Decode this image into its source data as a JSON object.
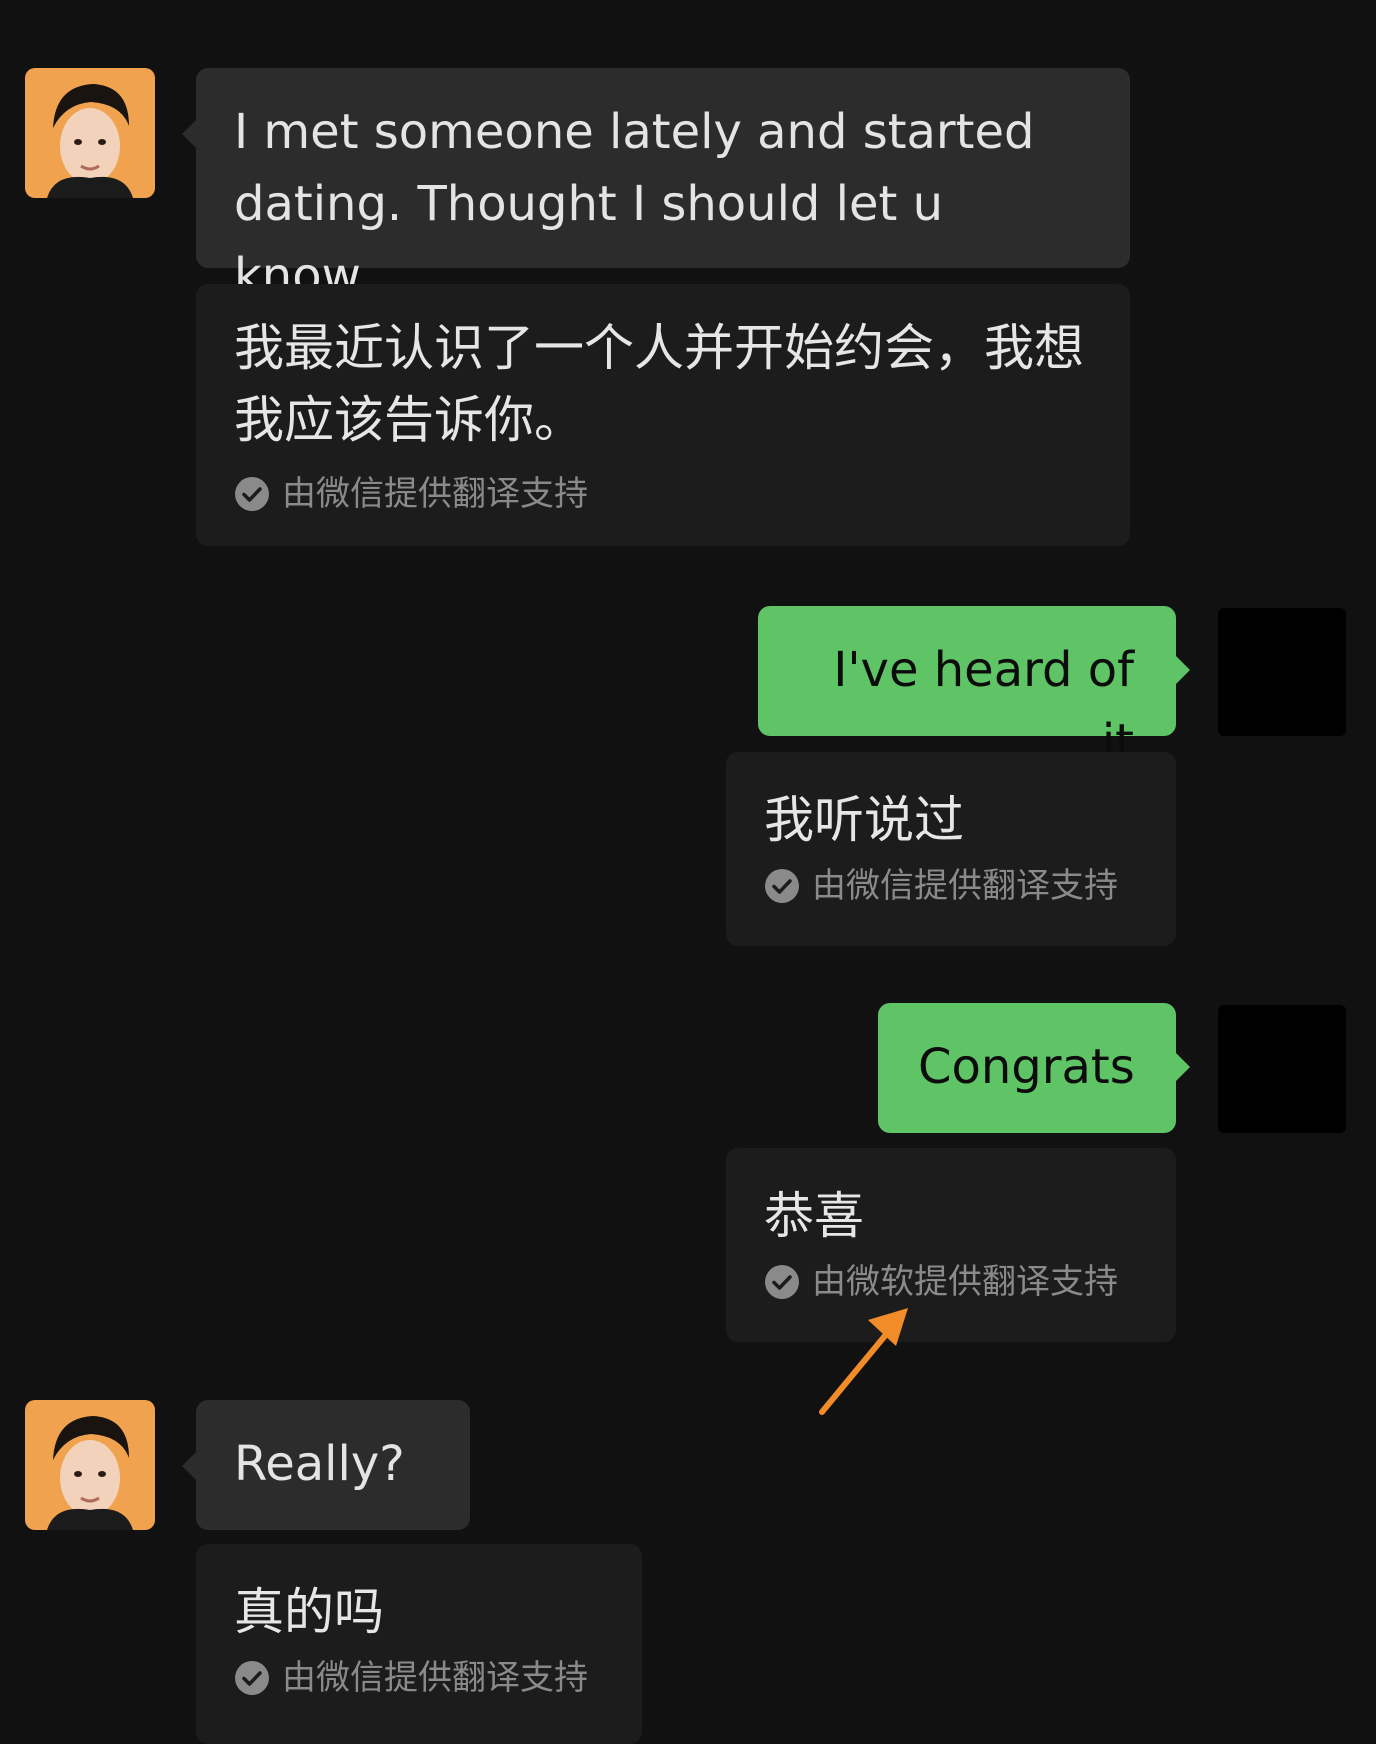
{
  "colors": {
    "background": "#111111",
    "incoming_bubble": "#2c2c2c",
    "outgoing_bubble": "#5fc466",
    "translation_card": "#1c1c1c",
    "attribution_text": "#8a8a8a",
    "annotation_arrow": "#f28c28"
  },
  "messages": [
    {
      "side": "left",
      "text": "I met someone lately and started dating.  Thought I should let u know.",
      "translation": "我最近认识了一个人并开始约会，我想我应该告诉你。",
      "attribution": "由微信提供翻译支持"
    },
    {
      "side": "right",
      "text": "I've heard of it",
      "translation": "我听说过",
      "attribution": "由微信提供翻译支持"
    },
    {
      "side": "right",
      "text": "Congrats",
      "translation": "恭喜",
      "attribution": "由微软提供翻译支持"
    },
    {
      "side": "left",
      "text": "Really?",
      "translation": "真的吗",
      "attribution": "由微信提供翻译支持"
    }
  ],
  "icons": {
    "avatar": "contact-avatar-photo",
    "self_avatar": "redacted-avatar",
    "check": "check-circle-icon",
    "arrow": "annotation-arrow-icon"
  }
}
